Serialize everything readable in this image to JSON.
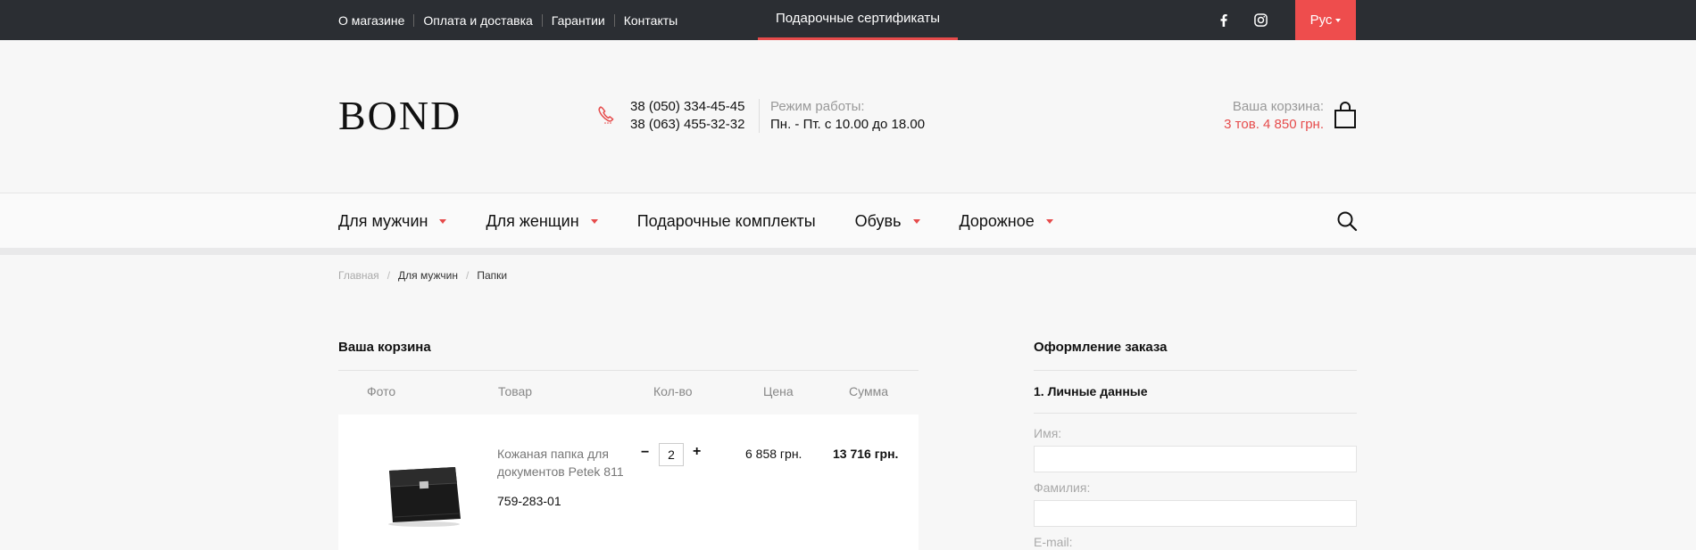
{
  "topbar": {
    "links": [
      "О магазине",
      "Оплата и доставка",
      "Гарантии",
      "Контакты"
    ],
    "gift_label": "Подарочные сертификаты",
    "lang": "Рус"
  },
  "header": {
    "logo": "BOND",
    "phone1": "38 (050) 334-45-45",
    "phone2": "38 (063) 455-32-32",
    "hours_label": "Режим работы:",
    "hours_value": "Пн. - Пт. с 10.00 до 18.00",
    "cart_label": "Ваша корзина:",
    "cart_value": "3 тов. 4 850 грн."
  },
  "nav": {
    "items": [
      {
        "label": "Для мужчин",
        "caret": true
      },
      {
        "label": "Для женщин",
        "caret": true
      },
      {
        "label": "Подарочные комплекты",
        "caret": false
      },
      {
        "label": "Обувь",
        "caret": true
      },
      {
        "label": "Дорожное",
        "caret": true
      }
    ]
  },
  "breadcrumb": {
    "home": "Главная",
    "level1": "Для мужчин",
    "current": "Папки"
  },
  "cart": {
    "title": "Ваша корзина",
    "headers": {
      "photo": "Фото",
      "product": "Товар",
      "qty": "Кол-во",
      "price": "Цена",
      "sum": "Сумма"
    },
    "item": {
      "name": "Кожаная папка для документов Petek 811",
      "sku": "759-283-01",
      "qty": "2",
      "price": "6 858 грн.",
      "sum": "13 716 грн."
    }
  },
  "order": {
    "title": "Оформление заказа",
    "step1": "1. Личные данные",
    "name_label": "Имя:",
    "surname_label": "Фамилия:",
    "email_label": "E-mail:"
  },
  "colors": {
    "accent": "#e64b4b",
    "topbar": "#2b2e33"
  }
}
